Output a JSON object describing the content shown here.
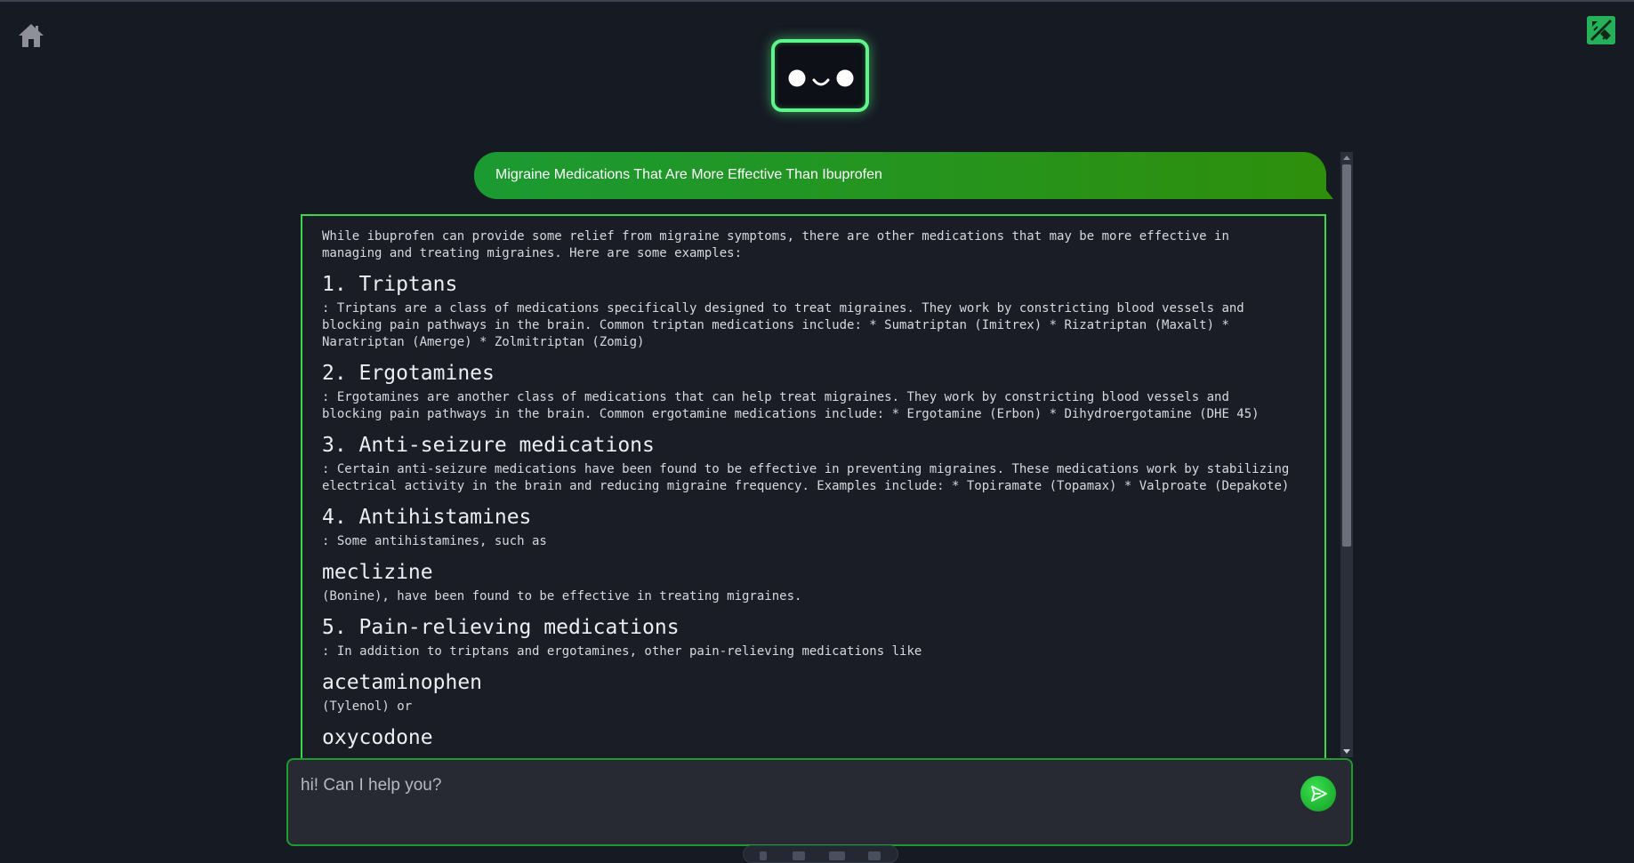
{
  "app": {
    "home_icon": "home-icon",
    "corner_icon": "edit-brush-icon",
    "avatar_icon": "robot-face-icon"
  },
  "colors": {
    "background": "#161a23",
    "accent_green": "#3dd74d",
    "user_bubble": "#1b9a32",
    "bot_panel": "#1a1d26",
    "input_panel": "#272a33"
  },
  "chat": {
    "user_message": "Migraine Medications That Are More Effective Than Ibuprofen",
    "bot_response": {
      "intro": "While ibuprofen can provide some relief from migraine symptoms, there are other medications that may be more effective in managing and treating migraines. Here are some examples:",
      "sections": [
        {
          "heading": "1. Triptans",
          "text": ": Triptans are a class of medications specifically designed to treat migraines. They work by constricting blood vessels and blocking pain pathways in the brain. Common triptan medications include: * Sumatriptan (Imitrex) * Rizatriptan (Maxalt) * Naratriptan (Amerge) * Zolmitriptan (Zomig)"
        },
        {
          "heading": "2. Ergotamines",
          "text": ": Ergotamines are another class of medications that can help treat migraines. They work by constricting blood vessels and blocking pain pathways in the brain. Common ergotamine medications include: * Ergotamine (Erbon) * Dihydroergotamine (DHE 45)"
        },
        {
          "heading": "3. Anti-seizure medications",
          "text": ": Certain anti-seizure medications have been found to be effective in preventing migraines. These medications work by stabilizing electrical activity in the brain and reducing migraine frequency. Examples include: * Topiramate (Topamax) * Valproate (Depakote)"
        },
        {
          "heading": "4. Antihistamines",
          "text": ": Some antihistamines, such as"
        },
        {
          "heading": "meclizine",
          "text": "(Bonine), have been found to be effective in treating migraines."
        },
        {
          "heading": "5. Pain-relieving medications",
          "text": ": In addition to triptans and ergotamines, other pain-relieving medications like"
        },
        {
          "heading": "acetaminophen",
          "text": "(Tylenol) or"
        },
        {
          "heading": "oxycodone",
          "text": ""
        }
      ]
    }
  },
  "input": {
    "placeholder": "hi! Can I help you?",
    "value": "",
    "send_icon": "send-icon"
  }
}
